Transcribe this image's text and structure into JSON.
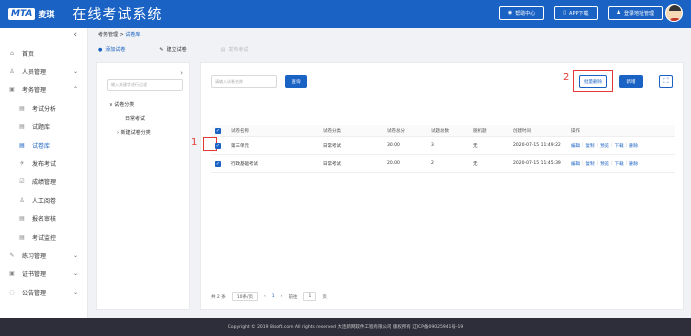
{
  "header": {
    "logo_mark": "MTA",
    "logo_text": "麦琪",
    "app_title": "在线考试系统",
    "actions": [
      {
        "icon": "help-icon",
        "glyph": "◉",
        "label": "帮助中心"
      },
      {
        "icon": "phone-icon",
        "glyph": "▯",
        "label": "APP下载"
      },
      {
        "icon": "user-icon",
        "glyph": "♟",
        "label": "登录地址管理"
      }
    ]
  },
  "sidebar": {
    "collapse_glyph": "‹",
    "items": [
      {
        "icon": "home-icon",
        "glyph": "⌂",
        "label": "首页",
        "chevron": ""
      },
      {
        "icon": "users-icon",
        "glyph": "♙",
        "label": "人员管理",
        "chevron": "⌄"
      },
      {
        "icon": "exam-icon",
        "glyph": "▣",
        "label": "考务管理",
        "chevron": "⌃"
      },
      {
        "icon": "analysis-icon",
        "glyph": "▤",
        "label": "考试分析",
        "chevron": "",
        "sub": true
      },
      {
        "icon": "question-bank-icon",
        "glyph": "▤",
        "label": "试题库",
        "chevron": "",
        "sub": true
      },
      {
        "icon": "paper-bank-icon",
        "glyph": "▤",
        "label": "试卷库",
        "chevron": "",
        "sub": true,
        "active": true
      },
      {
        "icon": "publish-icon",
        "glyph": "✈",
        "label": "发布考试",
        "chevron": "",
        "sub": true
      },
      {
        "icon": "score-icon",
        "glyph": "☑",
        "label": "成绩管理",
        "chevron": "",
        "sub": true
      },
      {
        "icon": "review-icon",
        "glyph": "♙",
        "label": "人工阅卷",
        "chevron": "",
        "sub": true
      },
      {
        "icon": "audit-icon",
        "glyph": "▤",
        "label": "报名审核",
        "chevron": "",
        "sub": true
      },
      {
        "icon": "monitor-icon",
        "glyph": "▤",
        "label": "考试监控",
        "chevron": "",
        "sub": true
      },
      {
        "icon": "practice-icon",
        "glyph": "✎",
        "label": "练习管理",
        "chevron": "⌄"
      },
      {
        "icon": "certificate-icon",
        "glyph": "▣",
        "label": "证书管理",
        "chevron": "⌄"
      },
      {
        "icon": "notice-icon",
        "glyph": "◌",
        "label": "公告管理",
        "chevron": "⌄"
      }
    ]
  },
  "breadcrumb": {
    "parent": "考务管理",
    "sep": " > ",
    "current": "试卷库"
  },
  "steps": [
    {
      "icon": "add-paper-icon",
      "glyph": "●",
      "label": "添加试卷",
      "state": "active"
    },
    {
      "icon": "build-paper-icon",
      "glyph": "✎",
      "label": "建立试卷",
      "state": "normal"
    },
    {
      "icon": "publish-exam-icon",
      "glyph": "▤",
      "label": "发布考试",
      "state": "disabled"
    }
  ],
  "tree": {
    "search_placeholder": "输入关键字进行过滤",
    "toggle_glyph": "›",
    "nodes": [
      {
        "label": "∨  试卷分类"
      },
      {
        "label": "日常考试"
      },
      {
        "label": "›  新建试卷分类"
      }
    ]
  },
  "table_panel": {
    "search_placeholder": "请输入试卷名称",
    "query_label": "查询",
    "batch_delete_label": "批量删除",
    "new_label": "新增",
    "fullscreen_glyph": "⛶",
    "annotation_1": "1",
    "annotation_2": "2",
    "columns": [
      "试卷名称",
      "试卷分类",
      "试卷总分",
      "试题总数",
      "随机题",
      "创建时间",
      "操作"
    ],
    "rows": [
      {
        "name": "第三单元",
        "category": "日常考试",
        "total": "30.00",
        "count": "3",
        "random": "无",
        "created": "2020-07-15 11:49:22",
        "checked": true
      },
      {
        "name": "行政基础考试",
        "category": "日常考试",
        "total": "20.00",
        "count": "2",
        "random": "无",
        "created": "2020-07-15 11:45:39",
        "checked": true
      }
    ],
    "row_ops": [
      "编辑",
      "复制",
      "预览",
      "下载",
      "删除"
    ],
    "pager": {
      "total": "共 2 条",
      "page_size": "10条/页",
      "prev": "‹",
      "page": "1",
      "next": "›",
      "goto_label": "前往",
      "goto_value": "1",
      "goto_unit": "页"
    }
  },
  "footer": {
    "text": "Copyright © 2019 8isoft.com All rights reserved 大连新网软件工程有限公司 版权所有 辽ICP备09025941号-19"
  },
  "colors": {
    "primary": "#1a62c4",
    "annotation": "#e53935"
  }
}
